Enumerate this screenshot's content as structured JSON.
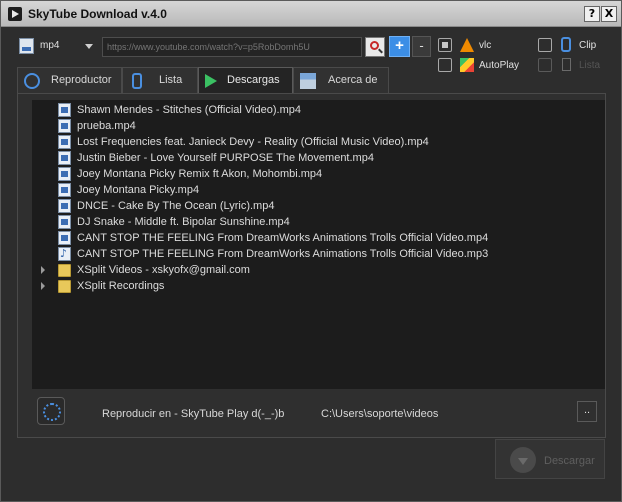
{
  "window": {
    "title": "SkyTube Download v.4.0",
    "help_label": "?",
    "close_label": "X"
  },
  "toolbar": {
    "format_value": "mp4",
    "url_placeholder": "https://www.youtube.com/watch?v=p5RobDomh5U",
    "add_label": "+",
    "remove_label": "-",
    "vlc_label": "vlc",
    "autoplay_label": "AutoPlay",
    "clip_label": "Clip",
    "list_label": "Lista"
  },
  "tabs": [
    {
      "label": "Reproductor"
    },
    {
      "label": "Lista"
    },
    {
      "label": "Descargas"
    },
    {
      "label": "Acerca de"
    }
  ],
  "files": [
    {
      "name": "Shawn Mendes - Stitches (Official Video).mp4",
      "type": "mp4"
    },
    {
      "name": "prueba.mp4",
      "type": "mp4"
    },
    {
      "name": "Lost Frequencies feat. Janieck Devy - Reality (Official Music Video).mp4",
      "type": "mp4"
    },
    {
      "name": "Justin Bieber - Love Yourself PURPOSE The Movement.mp4",
      "type": "mp4"
    },
    {
      "name": "Joey Montana  Picky Remix ft Akon, Mohombi.mp4",
      "type": "mp4"
    },
    {
      "name": "Joey Montana  Picky.mp4",
      "type": "mp4"
    },
    {
      "name": "DNCE - Cake By The Ocean (Lyric).mp4",
      "type": "mp4"
    },
    {
      "name": "DJ Snake - Middle ft. Bipolar Sunshine.mp4",
      "type": "mp4"
    },
    {
      "name": "CANT STOP THE FEELING From DreamWorks Animations Trolls Official Video.mp4",
      "type": "mp4"
    },
    {
      "name": "CANT STOP THE FEELING From DreamWorks Animations Trolls Official Video.mp3",
      "type": "mp3"
    },
    {
      "name": "XSplit Videos - xskyofx@gmail.com",
      "type": "folder"
    },
    {
      "name": "XSplit Recordings",
      "type": "folder"
    }
  ],
  "footer": {
    "player_text": "Reproducir en  -  SkyTube Play d(-_-)b",
    "path_text": "C:\\Users\\soporte\\videos",
    "browse_label": ".."
  },
  "download": {
    "label": "Descargar"
  }
}
